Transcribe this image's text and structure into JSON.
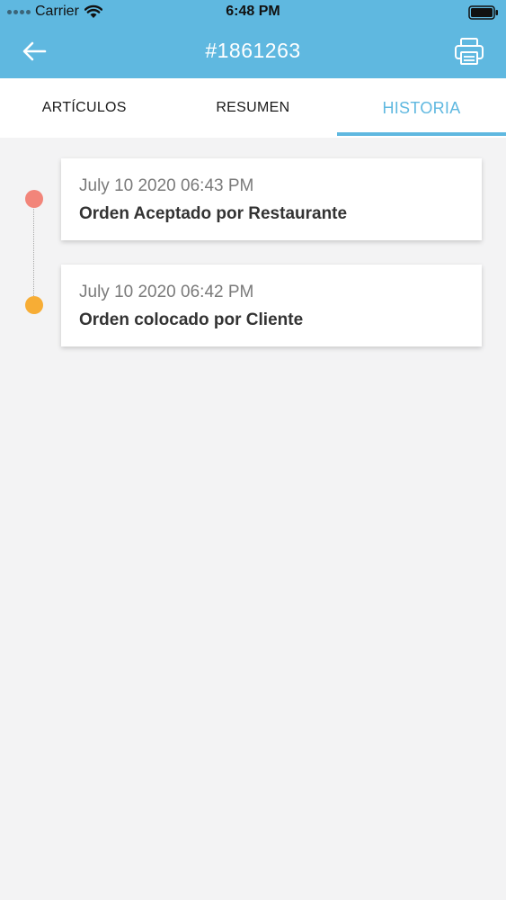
{
  "status_bar": {
    "carrier": "Carrier",
    "time": "6:48 PM"
  },
  "header": {
    "title": "#1861263",
    "back_icon": "arrow-left-icon",
    "print_icon": "printer-icon",
    "background_color": "#5fb8e0"
  },
  "tabs": [
    {
      "label": "ARTÍCULOS",
      "active": false
    },
    {
      "label": "RESUMEN",
      "active": false
    },
    {
      "label": "HISTORIA",
      "active": true
    }
  ],
  "history": [
    {
      "time": "July 10 2020 06:43 PM",
      "description": "Orden Aceptado por Restaurante",
      "dot_color": "#f2857a"
    },
    {
      "time": "July 10 2020 06:42 PM",
      "description": "Orden colocado por Cliente",
      "dot_color": "#f7ad35"
    }
  ]
}
